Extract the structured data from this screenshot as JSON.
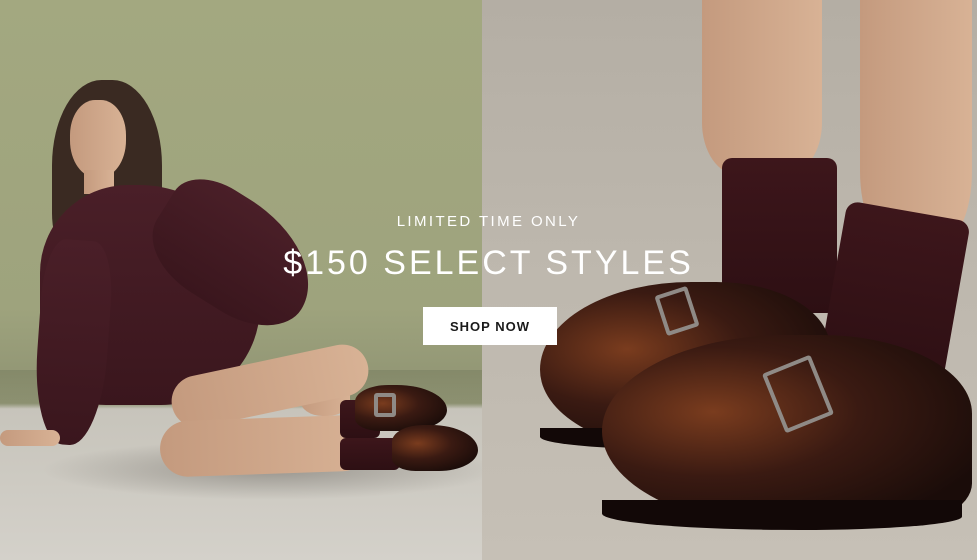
{
  "banner": {
    "eyebrow": "LIMITED TIME ONLY",
    "headline": "$150 SELECT STYLES",
    "cta_label": "SHOP NOW"
  },
  "colors": {
    "text_on_image": "#ffffff",
    "button_bg": "#ffffff",
    "button_text": "#1a1a1a"
  }
}
